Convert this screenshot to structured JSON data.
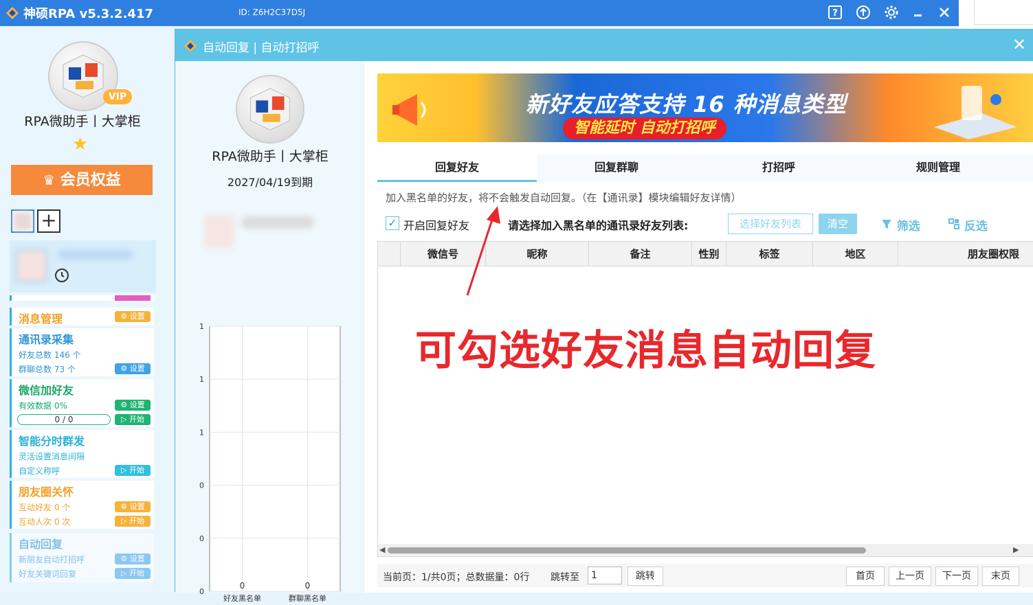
{
  "app": {
    "title": "神硕RPA v5.3.2.417",
    "device_id": "ID: Z6H2C37D5J"
  },
  "sidebar": {
    "user_name": "RPA微助手丨大掌柜",
    "vip_badge": "VIP",
    "member_button": "会员权益",
    "modules": [
      {
        "title": "消息管理",
        "btn1": "设置"
      },
      {
        "title": "通讯录采集",
        "sub1": "好友总数 146 个",
        "sub2": "群聊总数 73 个",
        "btn1": "设置"
      },
      {
        "title": "微信加好友",
        "sub1": "有效数据 0%",
        "progress": "0 / 0",
        "btn1": "设置",
        "btn2": "开始"
      },
      {
        "title": "智能分时群发",
        "sub1": "灵活设置消息间隔",
        "sub2": "自定义称呼",
        "btn1": "开始"
      },
      {
        "title": "朋友圈关怀",
        "sub1": "互动好友 0 个",
        "sub2": "互动人次 0 次",
        "btn1": "设置",
        "btn2": "开始"
      },
      {
        "title": "自动回复",
        "sub1": "新朋友自动打招呼",
        "sub2": "好友关键词回复",
        "btn1": "设置",
        "btn2": "开始"
      }
    ]
  },
  "dialog": {
    "title": "自动回复 | 自动打招呼",
    "profile": {
      "name": "RPA微助手丨大掌柜",
      "expiry": "2027/04/19到期"
    },
    "chart_data": {
      "type": "bar",
      "categories": [
        "好友黑名单",
        "群聊黑名单"
      ],
      "values": [
        0,
        0
      ],
      "y_tick_labels": [
        "1",
        "1",
        "1",
        "0",
        "0",
        "0"
      ],
      "data_labels": [
        "0",
        "0"
      ]
    },
    "banner": {
      "headline": "新好友应答支持 16 种消息类型",
      "subline": "智能延时 自动打招呼"
    },
    "tabs": [
      "回复好友",
      "回复群聊",
      "打招呼",
      "规则管理"
    ],
    "active_tab": 0,
    "note": "加入黑名单的好友，将不会触发自动回复。（在【通讯录】模块编辑好友详情）",
    "toolbar": {
      "enable_label": "开启回复好友",
      "enabled": true,
      "list_label": "请选择加入黑名单的通讯录好友列表:",
      "select_button": "选择好友列表",
      "clear_button": "清空",
      "filter_button": "筛选",
      "invert_button": "反选"
    },
    "table": {
      "columns": [
        "微信号",
        "昵称",
        "备注",
        "性别",
        "标签",
        "地区",
        "朋友圈权限"
      ],
      "rows": []
    },
    "pager": {
      "info": "当前页：1/共0页；总数据量：0行",
      "jump_label": "跳转至",
      "page_input": "1",
      "jump_button": "跳转",
      "first": "首页",
      "prev": "上一页",
      "next": "下一页",
      "last": "末页"
    },
    "annotation": "可勾选好友消息自动回复"
  },
  "colors": {
    "topbar": "#2f7fe0",
    "dialog_header": "#5fc3e6",
    "annotation": "#e8282c"
  }
}
